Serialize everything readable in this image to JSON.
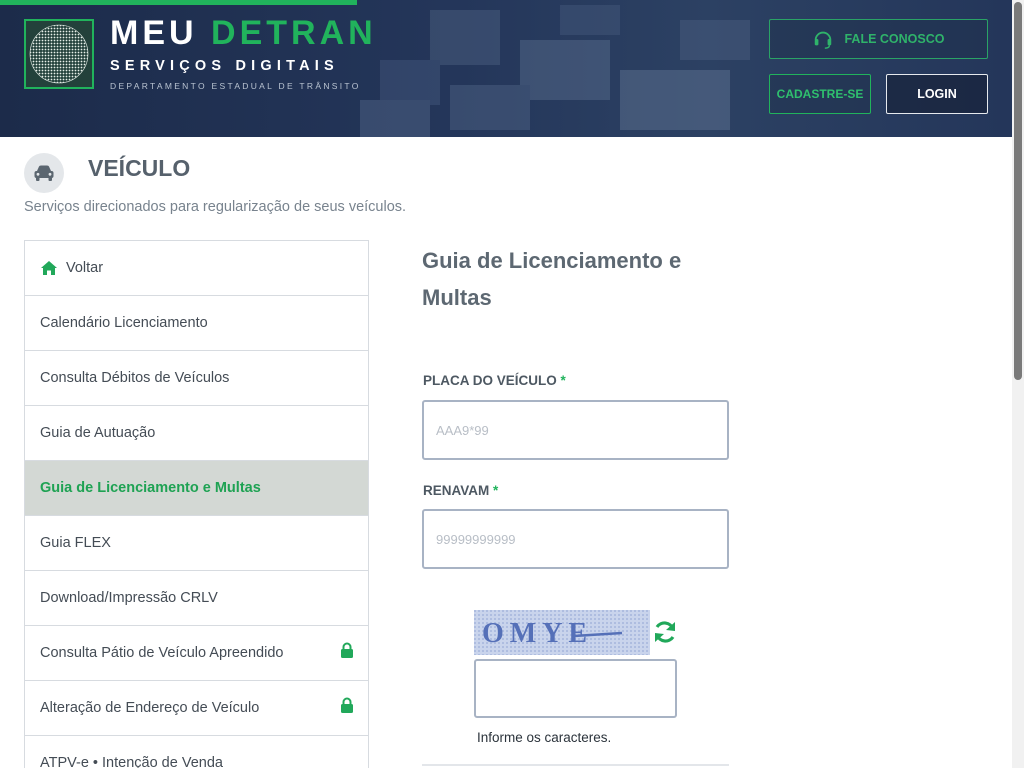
{
  "header": {
    "brand_word1": "MEU",
    "brand_word2": "DETRAN",
    "subtitle": "SERVIÇOS DIGITAIS",
    "department": "DEPARTAMENTO ESTADUAL DE TRÂNSITO",
    "contact_label": "FALE CONOSCO",
    "signup_label": "CADASTRE-SE",
    "login_label": "LOGIN"
  },
  "page": {
    "title": "VEÍCULO",
    "description": "Serviços direcionados para regularização de seus veículos."
  },
  "sidebar": {
    "items": [
      {
        "label": "Voltar",
        "icon": "home-icon"
      },
      {
        "label": "Calendário Licenciamento"
      },
      {
        "label": "Consulta Débitos de Veículos"
      },
      {
        "label": "Guia de Autuação"
      },
      {
        "label": "Guia de Licenciamento e Multas",
        "active": true
      },
      {
        "label": "Guia FLEX"
      },
      {
        "label": "Download/Impressão CRLV"
      },
      {
        "label": "Consulta Pátio de Veículo Apreendido",
        "icon": "lock-icon"
      },
      {
        "label": "Alteração de Endereço de Veículo",
        "icon": "lock-icon"
      },
      {
        "label": "ATPV-e • Intenção de Venda"
      }
    ]
  },
  "form": {
    "title": "Guia de Licenciamento e Multas",
    "placa_label": "PLACA DO VEÍCULO",
    "placa_placeholder": "AAA9*99",
    "renavam_label": "RENAVAM",
    "renavam_placeholder": "99999999999",
    "required_mark": "*",
    "captcha_text": "OMYE",
    "captcha_help": "Informe os caracteres.",
    "captcha_value": ""
  },
  "colors": {
    "brand_green": "#21b35c",
    "header_navy": "#1c2b4a",
    "active_bg": "#d3d8d4"
  }
}
